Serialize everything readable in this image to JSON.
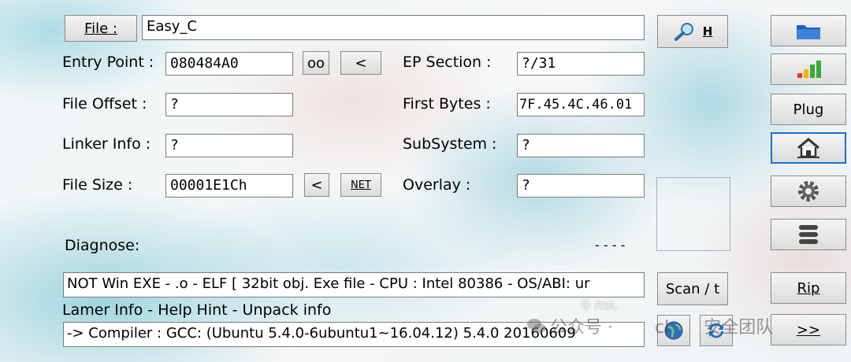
{
  "file_button_label": "File :",
  "file_path": "Easy_C",
  "search_button_label": "H",
  "entry_point": {
    "label": "Entry Point :",
    "value": "080484A0",
    "oo_label": "oo",
    "lt_label": "<"
  },
  "ep_section": {
    "label": "EP Section :",
    "value": "?/31"
  },
  "file_offset": {
    "label": "File Offset :",
    "value": "?"
  },
  "first_bytes": {
    "label": "First Bytes :",
    "value": "7F.45.4C.46.01"
  },
  "linker_info": {
    "label": "Linker Info :",
    "value": "?"
  },
  "subsystem": {
    "label": "SubSystem :",
    "value": "?"
  },
  "file_size": {
    "label": "File Size :",
    "value": "00001E1Ch",
    "lt_label": "<",
    "net_label": "NET"
  },
  "overlay": {
    "label": "Overlay :",
    "value": "?"
  },
  "diagnose": {
    "label": "Diagnose:",
    "dashes": "- - - -"
  },
  "scan_result": "NOT Win EXE - .o - ELF  [ 32bit obj. Exe file - CPU : Intel 80386 - OS/ABI: ur",
  "links": {
    "lamer": "Lamer Info",
    "help": "Help Hint",
    "unpack": "Unpack info",
    "sep": " - "
  },
  "timing": "0 ms.",
  "compiler": " -> Compiler : GCC: (Ubuntu 5.4.0-6ubuntu1~16.04.12) 5.4.0 20160609",
  "side_buttons": {
    "plug": "Plug",
    "scan": "Scan / t",
    "rip": "Rip",
    "next": ">>"
  },
  "watermark": {
    "part1": "公众号 · ",
    "part2": "cl",
    "part3": "安全团队"
  },
  "colors": {
    "accent": "#1a6fd0",
    "field_bg": "#ffffff"
  }
}
